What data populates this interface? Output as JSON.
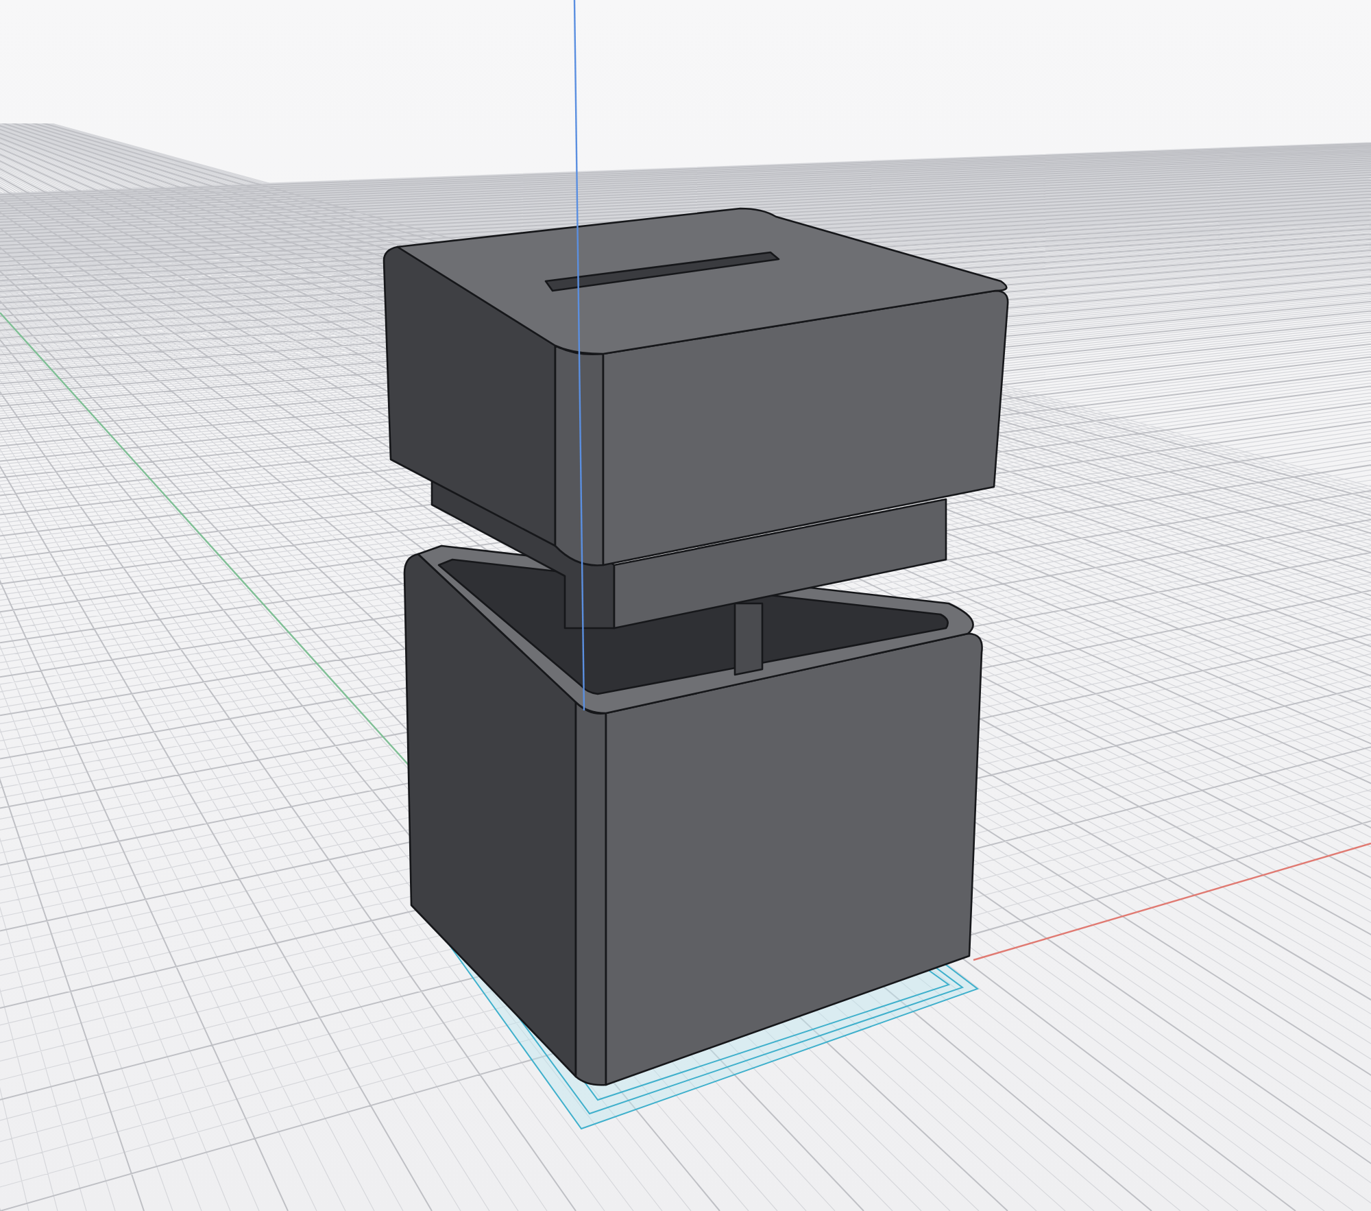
{
  "viewport": {
    "grid": true,
    "axes": true,
    "sketch": true
  }
}
